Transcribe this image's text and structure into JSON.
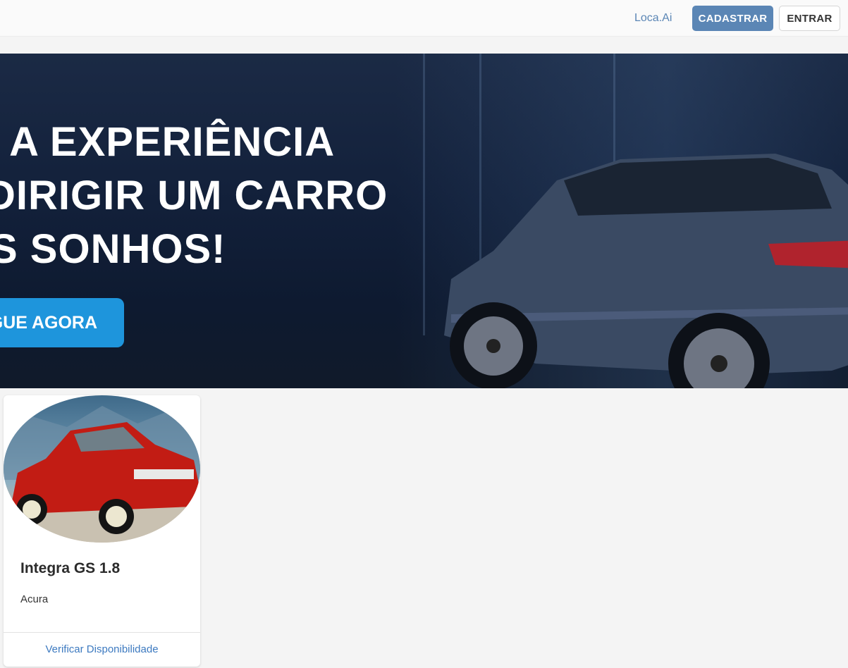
{
  "navbar": {
    "brand": "Loca.Ai",
    "register_label": "CADASTRAR",
    "login_label": "ENTRAR"
  },
  "banner": {
    "lines": [
      "VA A EXPERIÊNCIA",
      "DIRIGIR UM CARRO",
      "S SONHOS!"
    ],
    "cta_label": "GUE AGORA"
  },
  "cars": [
    {
      "name": "Integra GS 1.8",
      "brand": "Acura",
      "action_label": "Verificar Disponibilidade"
    }
  ],
  "colors": {
    "primary": "#5b86b5",
    "banner_cta": "#1e95dc",
    "link": "#3d7ac0",
    "background": "#f4f4f4"
  }
}
